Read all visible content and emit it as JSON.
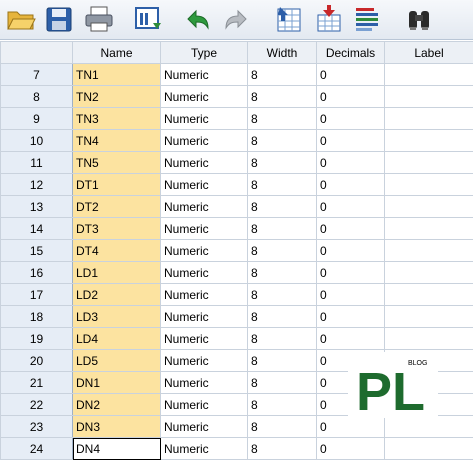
{
  "toolbar": {
    "buttons": [
      {
        "name": "open-folder-icon"
      },
      {
        "name": "save-icon"
      },
      {
        "name": "print-icon"
      },
      {
        "name": "dialog-recall-icon"
      },
      {
        "name": "undo-icon"
      },
      {
        "name": "redo-icon"
      },
      {
        "name": "goto-case-icon"
      },
      {
        "name": "goto-variable-icon"
      },
      {
        "name": "variables-icon"
      },
      {
        "name": "find-icon"
      }
    ]
  },
  "columns": [
    "Name",
    "Type",
    "Width",
    "Decimals",
    "Label"
  ],
  "rows": [
    {
      "num": "7",
      "name": "TN1",
      "type": "Numeric",
      "width": "8",
      "decimals": "0"
    },
    {
      "num": "8",
      "name": "TN2",
      "type": "Numeric",
      "width": "8",
      "decimals": "0"
    },
    {
      "num": "9",
      "name": "TN3",
      "type": "Numeric",
      "width": "8",
      "decimals": "0"
    },
    {
      "num": "10",
      "name": "TN4",
      "type": "Numeric",
      "width": "8",
      "decimals": "0"
    },
    {
      "num": "11",
      "name": "TN5",
      "type": "Numeric",
      "width": "8",
      "decimals": "0"
    },
    {
      "num": "12",
      "name": "DT1",
      "type": "Numeric",
      "width": "8",
      "decimals": "0"
    },
    {
      "num": "13",
      "name": "DT2",
      "type": "Numeric",
      "width": "8",
      "decimals": "0"
    },
    {
      "num": "14",
      "name": "DT3",
      "type": "Numeric",
      "width": "8",
      "decimals": "0"
    },
    {
      "num": "15",
      "name": "DT4",
      "type": "Numeric",
      "width": "8",
      "decimals": "0"
    },
    {
      "num": "16",
      "name": "LD1",
      "type": "Numeric",
      "width": "8",
      "decimals": "0"
    },
    {
      "num": "17",
      "name": "LD2",
      "type": "Numeric",
      "width": "8",
      "decimals": "0"
    },
    {
      "num": "18",
      "name": "LD3",
      "type": "Numeric",
      "width": "8",
      "decimals": "0"
    },
    {
      "num": "19",
      "name": "LD4",
      "type": "Numeric",
      "width": "8",
      "decimals": "0"
    },
    {
      "num": "20",
      "name": "LD5",
      "type": "Numeric",
      "width": "8",
      "decimals": "0"
    },
    {
      "num": "21",
      "name": "DN1",
      "type": "Numeric",
      "width": "8",
      "decimals": "0"
    },
    {
      "num": "22",
      "name": "DN2",
      "type": "Numeric",
      "width": "8",
      "decimals": "0"
    },
    {
      "num": "23",
      "name": "DN3",
      "type": "Numeric",
      "width": "8",
      "decimals": "0"
    },
    {
      "num": "24",
      "name": "DN4",
      "type": "Numeric",
      "width": "8",
      "decimals": "0"
    }
  ],
  "watermark": {
    "text": "PL",
    "tag": "BLOG",
    "color": "#1e6b2e"
  }
}
